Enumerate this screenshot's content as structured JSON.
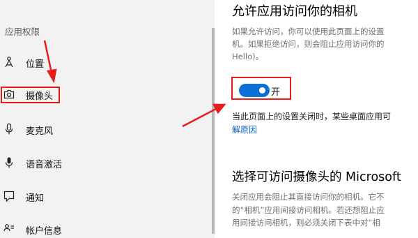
{
  "sidebar": {
    "section_title": "应用权限",
    "items": [
      {
        "label": "位置",
        "icon": "location-icon"
      },
      {
        "label": "摄像头",
        "icon": "camera-icon"
      },
      {
        "label": "麦克风",
        "icon": "microphone-icon"
      },
      {
        "label": "语音激活",
        "icon": "voice-activation-icon"
      },
      {
        "label": "通知",
        "icon": "notification-icon"
      },
      {
        "label": "帐户信息",
        "icon": "account-info-icon"
      }
    ]
  },
  "main": {
    "title": "允许应用访问你的相机",
    "description_lines": [
      "如果允许访问，你可以使用此页面上的设置",
      "机。如果拒绝访问，则会阻止应用访问你的",
      "Hello)。"
    ],
    "toggle": {
      "state_label": "开",
      "is_on": true
    },
    "note": "当此页面上的设置关闭时，某些桌面应用可",
    "link": "解原因",
    "section2_title": "选择可访问摄像头的 Microsoft",
    "section2_lines": [
      "关闭应用会阻止其直接访问你的相机。它不",
      "的“相机”应用间接访问相机。若还想阻止应",
      "用间接访问相机，则必须关闭下表中对“相"
    ]
  },
  "colors": {
    "sidebar_bg": "#f2f2f2",
    "accent": "#0a6fd6",
    "annotation_red": "#e81c1c",
    "link": "#0b61c4"
  }
}
